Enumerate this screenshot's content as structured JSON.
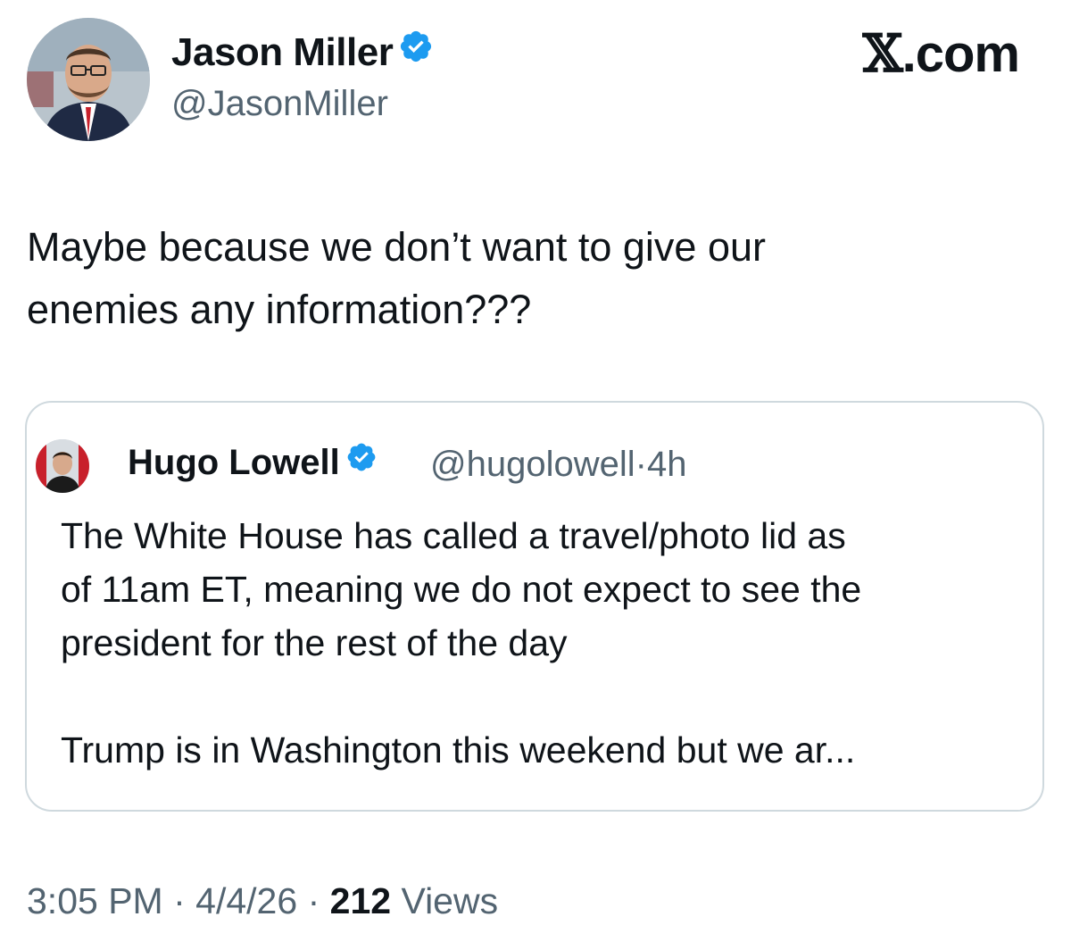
{
  "author": {
    "name": "Jason Miller",
    "handle": "@JasonMiller"
  },
  "brand": {
    "x_glyph": "𝕏",
    "domain": ".com"
  },
  "tweet": {
    "lines": [
      "Maybe because we don’t want to give our",
      "enemies any information???"
    ]
  },
  "quote": {
    "name": "Hugo Lowell",
    "handle": "@hugolowell",
    "separator": "·",
    "time": "4h",
    "paragraph1_lines": [
      "The White House has called a travel/photo lid as",
      "of 11am ET, meaning we do not expect to see the",
      "president for the rest of the day"
    ],
    "paragraph2": "Trump is in Washington this weekend but we ar..."
  },
  "meta": {
    "time": "3:05 PM",
    "separator": "·",
    "date": "4/4/26",
    "views_count": "212",
    "views_label": "Views"
  },
  "colors": {
    "verified_blue": "#1d9bf0",
    "text_primary": "#0f1419",
    "text_secondary": "#536471",
    "border": "#cfd9de"
  },
  "icons": {
    "verified": "verified-badge-icon"
  }
}
